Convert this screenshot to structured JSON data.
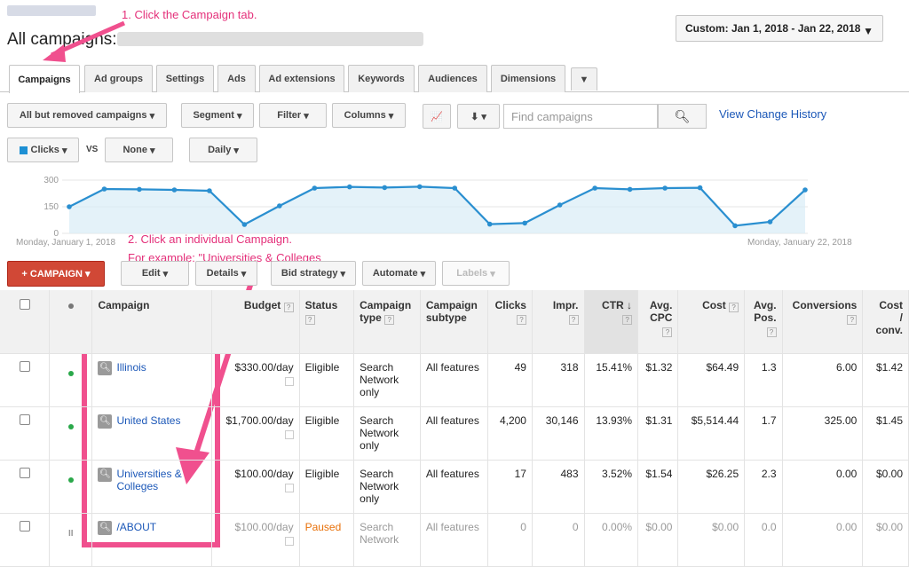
{
  "header": {
    "title": "All campaigns:",
    "date_range": "Custom: Jan 1, 2018 - Jan 22, 2018"
  },
  "annotations": {
    "step1": "1. Click the Campaign tab.",
    "step2_line1": "2. Click an individual Campaign.",
    "step2_line2": "For example: \"Universities & Colleges"
  },
  "tabs": [
    "Campaigns",
    "Ad groups",
    "Settings",
    "Ads",
    "Ad extensions",
    "Keywords",
    "Audiences",
    "Dimensions"
  ],
  "toolbar": {
    "filter_campaigns": "All but removed campaigns",
    "segment": "Segment",
    "filter": "Filter",
    "columns": "Columns",
    "search_placeholder": "Find campaigns",
    "change_history": "View Change History",
    "metric1": "Clicks",
    "vs": "VS",
    "metric2": "None",
    "granularity": "Daily"
  },
  "chart_data": {
    "type": "area",
    "series": [
      {
        "name": "Clicks",
        "color": "#2a8fd0",
        "values": [
          150,
          250,
          248,
          245,
          240,
          50,
          155,
          255,
          262,
          258,
          263,
          255,
          52,
          58,
          160,
          255,
          248,
          255,
          257,
          43,
          65,
          245
        ]
      }
    ],
    "ylim": [
      0,
      300
    ],
    "yticks": [
      "300",
      "150",
      "0"
    ],
    "x_start_label": "Monday, January 1, 2018",
    "x_end_label": "Monday, January 22, 2018"
  },
  "actions": {
    "add_campaign": "+ CAMPAIGN",
    "edit": "Edit",
    "details": "Details",
    "bid_strategy": "Bid strategy",
    "automate": "Automate",
    "labels": "Labels"
  },
  "table": {
    "headers": {
      "campaign": "Campaign",
      "budget": "Budget",
      "status": "Status",
      "type_l1": "Campaign",
      "type_l2": "type",
      "subtype_l1": "Campaign",
      "subtype_l2": "subtype",
      "clicks": "Clicks",
      "impr": "Impr.",
      "ctr": "CTR",
      "cpc_l1": "Avg.",
      "cpc_l2": "CPC",
      "cost": "Cost",
      "pos_l1": "Avg.",
      "pos_l2": "Pos.",
      "conversions": "Conversions",
      "cpconv_l1": "Cost",
      "cpconv_l2": "/",
      "cpconv_l3": "conv."
    },
    "rows": [
      {
        "campaign": "Illinois",
        "budget": "$330.00/day",
        "status": "Eligible",
        "type": "Search Network only",
        "subtype": "All features",
        "clicks": "49",
        "impr": "318",
        "ctr": "15.41%",
        "cpc": "$1.32",
        "cost": "$64.49",
        "pos": "1.3",
        "conversions": "6.00",
        "cpconv": "$1.42"
      },
      {
        "campaign": "United States",
        "budget": "$1,700.00/day",
        "status": "Eligible",
        "type": "Search Network only",
        "subtype": "All features",
        "clicks": "4,200",
        "impr": "30,146",
        "ctr": "13.93%",
        "cpc": "$1.31",
        "cost": "$5,514.44",
        "pos": "1.7",
        "conversions": "325.00",
        "cpconv": "$1.45"
      },
      {
        "campaign": "Universities & Colleges",
        "budget": "$100.00/day",
        "status": "Eligible",
        "type": "Search Network only",
        "subtype": "All features",
        "clicks": "17",
        "impr": "483",
        "ctr": "3.52%",
        "cpc": "$1.54",
        "cost": "$26.25",
        "pos": "2.3",
        "conversions": "0.00",
        "cpconv": "$0.00"
      },
      {
        "campaign": "/ABOUT",
        "budget": "$100.00/day",
        "status": "Paused",
        "type": "Search Network",
        "subtype": "All features",
        "clicks": "0",
        "impr": "0",
        "ctr": "0.00%",
        "cpc": "$0.00",
        "cost": "$0.00",
        "pos": "0.0",
        "conversions": "0.00",
        "cpconv": "$0.00"
      }
    ]
  }
}
